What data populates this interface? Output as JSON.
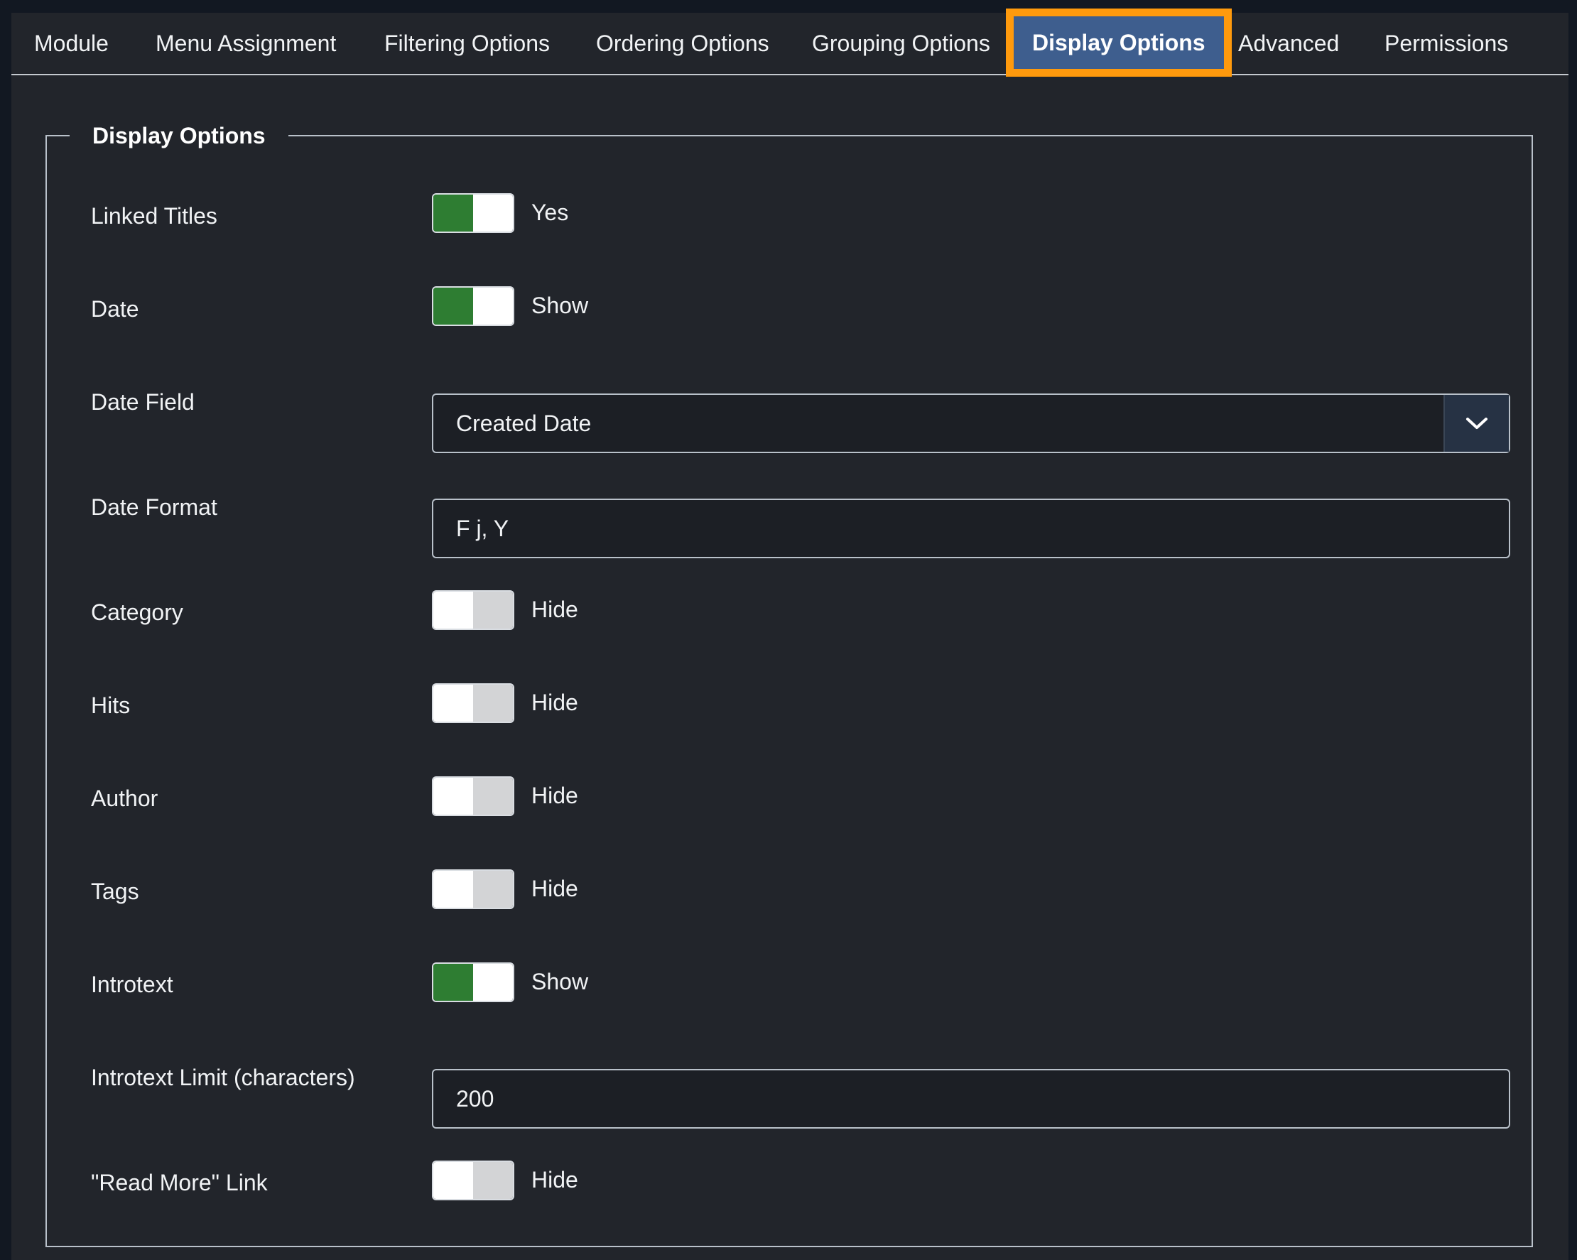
{
  "tabs": [
    {
      "label": "Module"
    },
    {
      "label": "Menu Assignment"
    },
    {
      "label": "Filtering Options"
    },
    {
      "label": "Ordering Options"
    },
    {
      "label": "Grouping Options"
    },
    {
      "label": "Display Options"
    },
    {
      "label": "Advanced"
    },
    {
      "label": "Permissions"
    }
  ],
  "active_tab": "Display Options",
  "fieldset": {
    "legend": "Display Options",
    "linked_titles": {
      "label": "Linked Titles",
      "state": "on",
      "text": "Yes"
    },
    "date": {
      "label": "Date",
      "state": "on",
      "text": "Show"
    },
    "date_field": {
      "label": "Date Field",
      "value": "Created Date",
      "icon": "chevron-down-icon"
    },
    "date_format": {
      "label": "Date Format",
      "value": "F j, Y"
    },
    "category": {
      "label": "Category",
      "state": "off",
      "text": "Hide"
    },
    "hits": {
      "label": "Hits",
      "state": "off",
      "text": "Hide"
    },
    "author": {
      "label": "Author",
      "state": "off",
      "text": "Hide"
    },
    "tags": {
      "label": "Tags",
      "state": "off",
      "text": "Hide"
    },
    "introtext": {
      "label": "Introtext",
      "state": "on",
      "text": "Show"
    },
    "introtext_limit": {
      "label": "Introtext Limit (characters)",
      "value": "200"
    },
    "read_more": {
      "label": "\"Read More\" Link",
      "state": "off",
      "text": "Hide"
    }
  },
  "colors": {
    "toggle_on": "#2e7d32",
    "active_tab_bg": "#3e5e8e",
    "highlight_border": "#ff9a0d",
    "panel_bg": "#22252b"
  }
}
